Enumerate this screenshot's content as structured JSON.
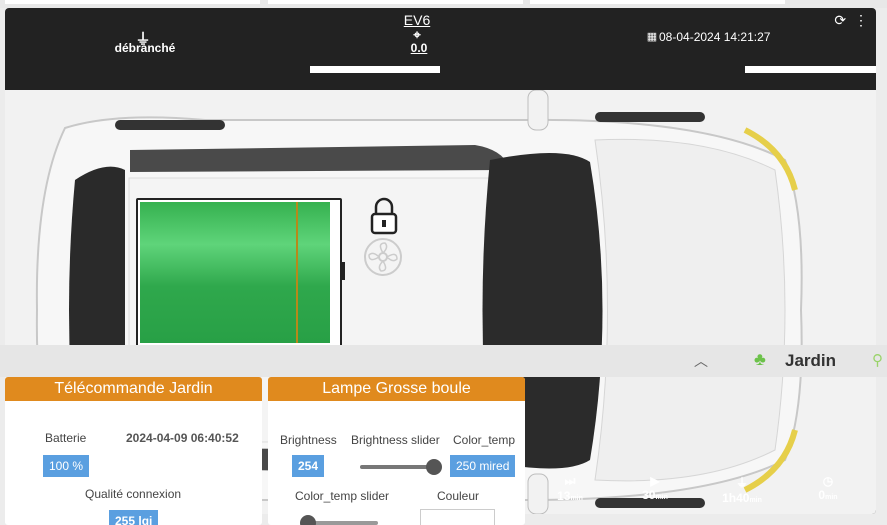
{
  "car": {
    "plug_status": "débranché",
    "vehicle_name": "EV6",
    "charge_power": "0.0",
    "datetime": "08-04-2024 14:21:27",
    "battery_color": "#2fa84c"
  },
  "band": {
    "room_name": "Jardin",
    "chevron": "^"
  },
  "timers": [
    {
      "icon": "fast-forward-icon",
      "glyph": "⏭",
      "value": "13",
      "unit": "min"
    },
    {
      "icon": "play-icon",
      "glyph": "▶",
      "value": "30",
      "unit": "min"
    },
    {
      "icon": "plug-icon",
      "glyph": "⏻",
      "value": "1h40",
      "unit": "min"
    },
    {
      "icon": "clock-icon",
      "glyph": "◷",
      "value": "0",
      "unit": "min"
    }
  ],
  "telecommande": {
    "title": "Télécommande Jardin",
    "battery_label": "Batterie",
    "battery_value": "100 %",
    "last_seen": "2024-04-09 06:40:52",
    "quality_label": "Qualité connexion",
    "quality_value": "255 lqi"
  },
  "lampe": {
    "title": "Lampe Grosse boule",
    "brightness_label": "Brightness",
    "brightness_value": "254",
    "brightness_slider_label": "Brightness slider",
    "brightness_slider_level": 0.95,
    "color_temp_label": "Color_temp",
    "color_temp_value": "250 mired",
    "color_temp_slider_label": "Color_temp slider",
    "color_temp_slider_level": 0.0,
    "couleur_label": "Couleur"
  }
}
